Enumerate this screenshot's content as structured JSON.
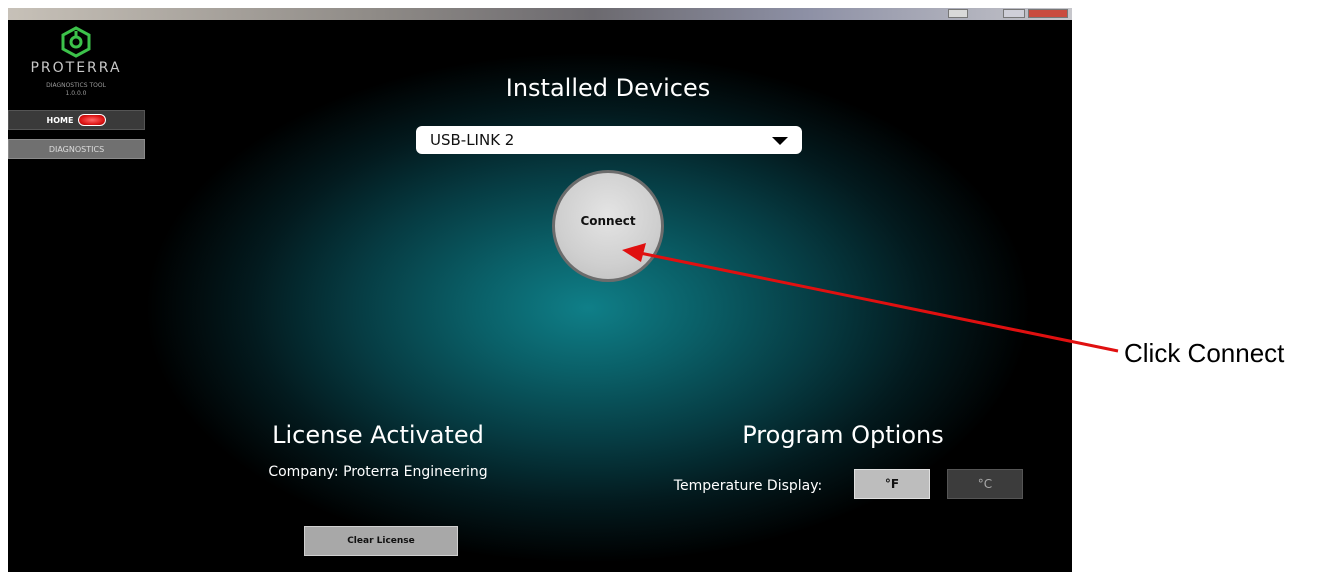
{
  "window": {
    "title_buttons": [
      "minimize",
      "maximize",
      "close"
    ]
  },
  "brand": {
    "name": "PROTERRA",
    "subtitle_line1": "DIAGNOSTICS TOOL",
    "subtitle_line2": "1.0.0.0",
    "logo_icon": "proterra-logo-icon",
    "accent_color": "#3cc24a"
  },
  "nav": {
    "home_label": "HOME",
    "diagnostics_label": "DIAGNOSTICS",
    "home_indicator_color": "#e01818"
  },
  "devices": {
    "title": "Installed Devices",
    "selected": "USB-LINK 2",
    "dropdown_icon": "triangle-down-icon"
  },
  "connect": {
    "label": "Connect"
  },
  "license": {
    "title": "License Activated",
    "company": "Company: Proterra Engineering",
    "clear_label": "Clear License"
  },
  "program_options": {
    "title": "Program Options",
    "temperature_label": "Temperature Display:",
    "fahrenheit_label": "°F",
    "celsius_label": "°C",
    "selected_unit": "°F"
  },
  "annotation": {
    "label": "Click Connect",
    "arrow_color": "#e01010"
  }
}
